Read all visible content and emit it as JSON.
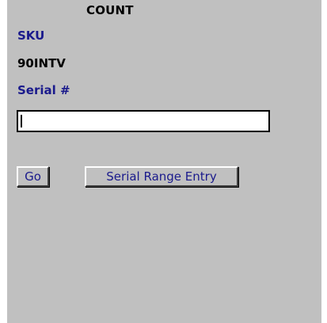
{
  "header": {
    "title": "COUNT"
  },
  "form": {
    "sku_label": "SKU",
    "sku_value": "90INTV",
    "serial_label": "Serial #",
    "serial_value": ""
  },
  "buttons": {
    "go_label": "Go",
    "serial_range_label": "Serial Range Entry"
  },
  "colors": {
    "background": "#c0c0c0",
    "label_blue": "#1a1a8c",
    "text_black": "#000000"
  }
}
